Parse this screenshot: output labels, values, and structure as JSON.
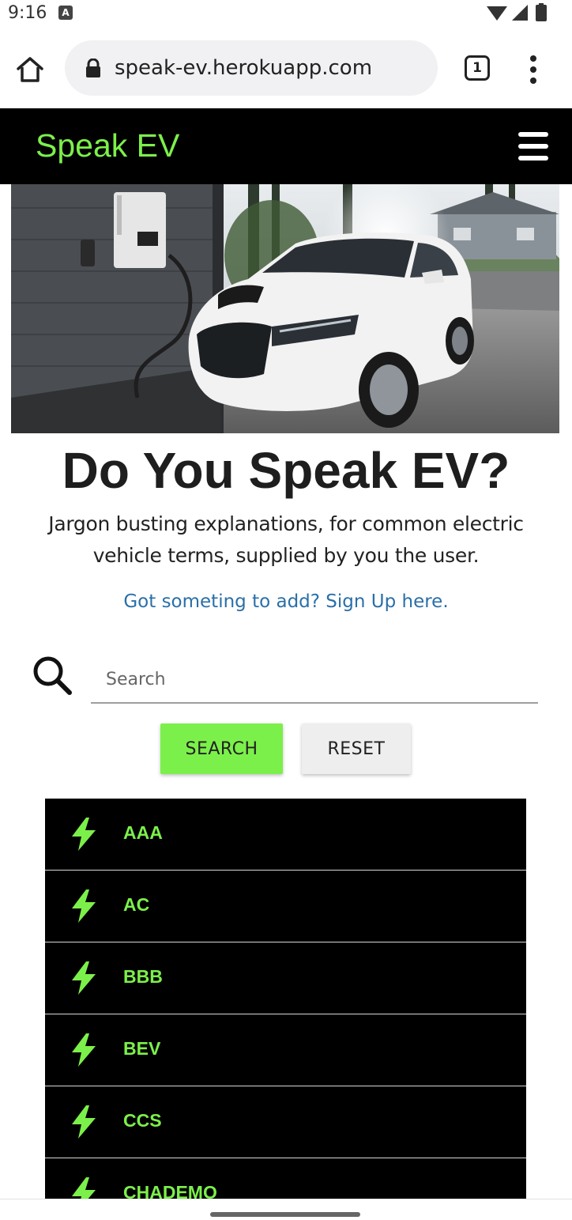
{
  "status_bar": {
    "time": "9:16",
    "notification_badge": "A"
  },
  "browser": {
    "url": "speak-ev.herokuapp.com",
    "tab_count": "1"
  },
  "site": {
    "brand": "Speak EV",
    "accent_color": "#7cf04a"
  },
  "hero": {
    "image_subject": "white electric car charging in garage"
  },
  "main": {
    "title": "Do You Speak EV?",
    "subtitle": "Jargon busting explanations, for common electric vehicle terms, supplied by you the user.",
    "signup_link": "Got someting to add? Sign Up here."
  },
  "search": {
    "placeholder": "Search",
    "value": "",
    "search_label": "SEARCH",
    "reset_label": "RESET"
  },
  "terms": [
    {
      "label": "AAA"
    },
    {
      "label": "AC"
    },
    {
      "label": "BBB"
    },
    {
      "label": "BEV"
    },
    {
      "label": "CCS"
    },
    {
      "label": "CHADEMO"
    }
  ]
}
